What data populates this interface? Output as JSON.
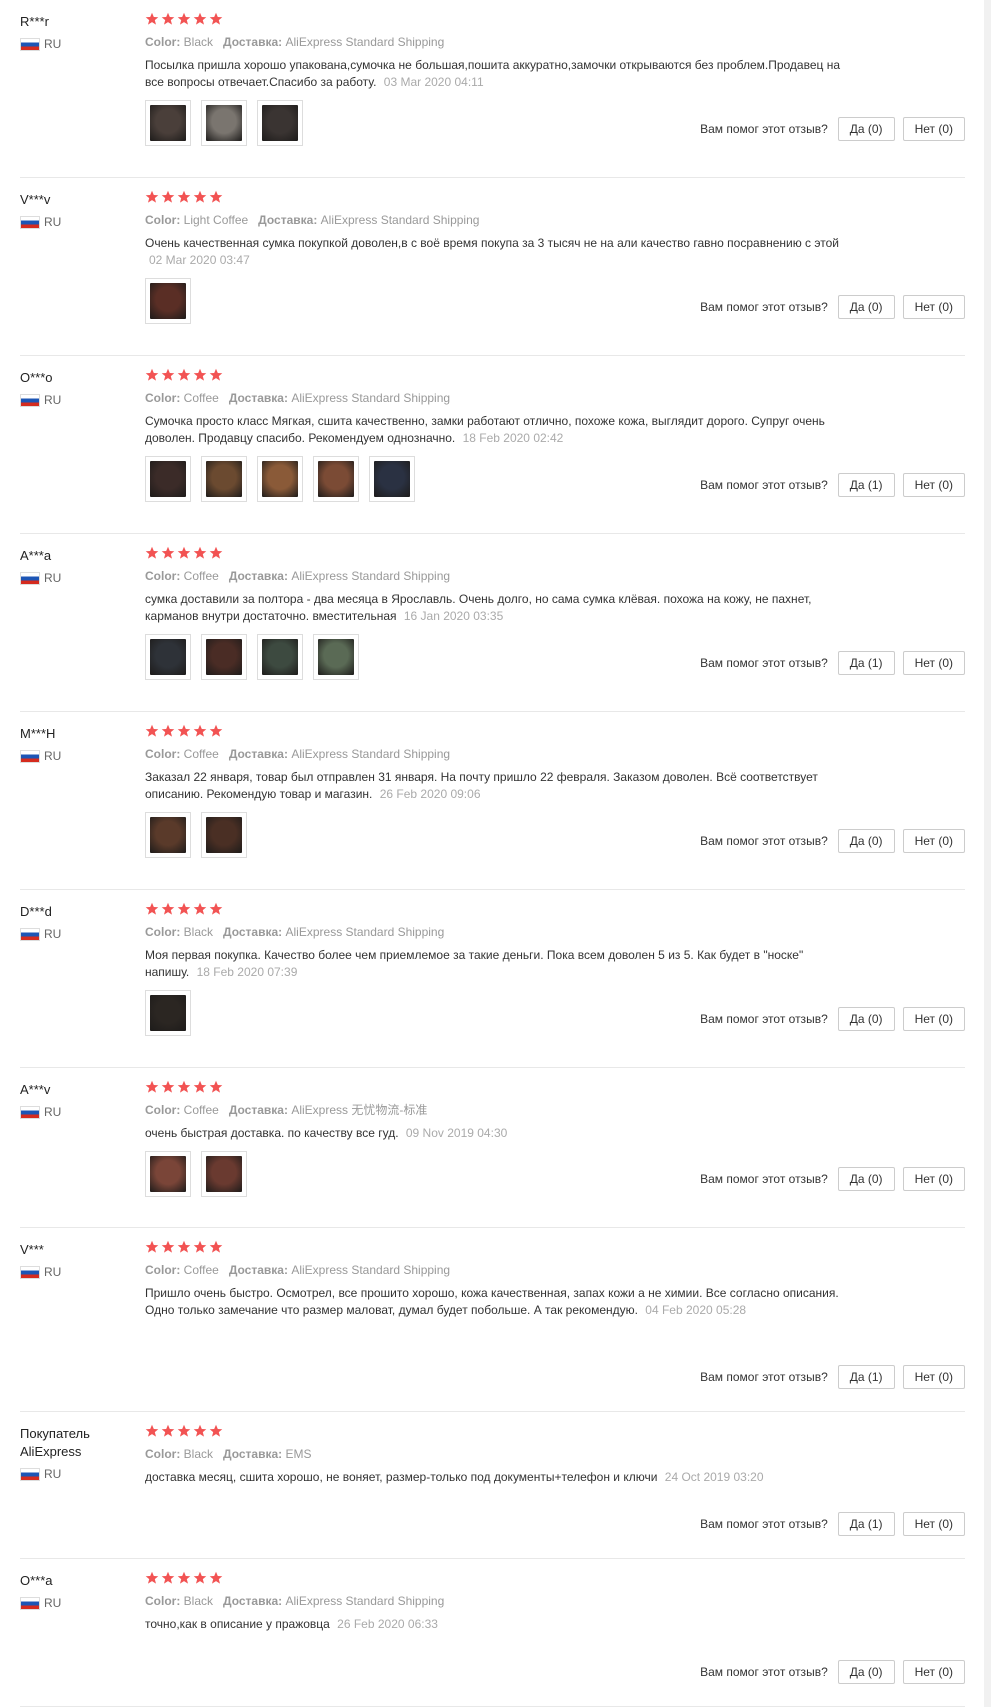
{
  "helpful_question": "Вам помог этот отзыв?",
  "color_key": "Color:",
  "shipping_key": "Доставка:",
  "colors": {
    "star": "#f25353",
    "country_text": "#666666"
  },
  "reviews": [
    {
      "user": "R***r",
      "country": "RU",
      "color": "Black",
      "shipping": "AliExpress Standard Shipping",
      "text": "Посылка пришла хорошо упакована,сумочка не большая,пошита аккуратно,замочки открываются без проблем.Продавец на все вопросы отвечает.Спасибо за работу.",
      "date": "03 Mar 2020 04:11",
      "photos": 3,
      "yes": "Да (0)",
      "no": "Нет (0)"
    },
    {
      "user": "V***v",
      "country": "RU",
      "color": "Light Coffee",
      "shipping": "AliExpress Standard Shipping",
      "text": "Очень качественная сумка покупкой доволен,в с воё время покупа за 3 тысяч не на али качество гавно посравнению с этой",
      "date": "02 Mar 2020 03:47",
      "photos": 1,
      "yes": "Да (0)",
      "no": "Нет (0)"
    },
    {
      "user": "O***o",
      "country": "RU",
      "color": "Coffee",
      "shipping": "AliExpress Standard Shipping",
      "text": "Сумочка просто класс Мягкая, сшита качественно, замки работают отлично, похоже кожа, выглядит дорого. Супруг очень доволен. Продавцу спасибо. Рекомендуем однозначно.",
      "date": "18 Feb 2020 02:42",
      "photos": 5,
      "yes": "Да (1)",
      "no": "Нет (0)"
    },
    {
      "user": "A***a",
      "country": "RU",
      "color": "Coffee",
      "shipping": "AliExpress Standard Shipping",
      "text": "сумка доставили за полтора - два месяца в Ярославль. Очень долго, но сама сумка клёвая. похожа на кожу, не пахнет, карманов внутри достаточно. вместительная",
      "date": "16 Jan 2020 03:35",
      "photos": 4,
      "yes": "Да (1)",
      "no": "Нет (0)"
    },
    {
      "user": "M***H",
      "country": "RU",
      "color": "Coffee",
      "shipping": "AliExpress Standard Shipping",
      "text": "Заказал 22 января, товар был отправлен 31 января. На почту пришло 22 февраля. Заказом доволен. Всё соответствует описанию. Рекомендую товар и магазин.",
      "date": "26 Feb 2020 09:06",
      "photos": 2,
      "yes": "Да (0)",
      "no": "Нет (0)"
    },
    {
      "user": "D***d",
      "country": "RU",
      "color": "Black",
      "shipping": "AliExpress Standard Shipping",
      "text": "Моя первая покупка. Качество более чем приемлемое за такие деньги. Пока всем доволен 5 из 5. Как будет в \"носке\" напишу.",
      "date": "18 Feb 2020 07:39",
      "photos": 1,
      "yes": "Да (0)",
      "no": "Нет (0)"
    },
    {
      "user": "A***v",
      "country": "RU",
      "color": "Coffee",
      "shipping": "AliExpress 无忧物流-标准",
      "text": "очень быстрая доставка. по качеству все гуд.",
      "date": "09 Nov 2019 04:30",
      "photos": 2,
      "yes": "Да (0)",
      "no": "Нет (0)"
    },
    {
      "user": "V***",
      "country": "RU",
      "color": "Coffee",
      "shipping": "AliExpress Standard Shipping",
      "text": "Пришло очень быстро. Осмотрел, все прошито хорошо, кожа качественная, запах кожи а не химии. Все согласно описания. Одно только замечание что размер маловат, думал будет побольше. А так рекомендую.",
      "date": "04 Feb 2020 05:28",
      "photos": 0,
      "yes": "Да (1)",
      "no": "Нет (0)"
    },
    {
      "user": "Покупатель AliExpress",
      "country": "RU",
      "color": "Black",
      "shipping": "EMS",
      "text": "доставка месяц, сшита хорошо, не воняет, размер-только под документы+телефон и ключи",
      "date": "24 Oct 2019 03:20",
      "photos": 0,
      "yes": "Да (1)",
      "no": "Нет (0)"
    },
    {
      "user": "O***a",
      "country": "RU",
      "color": "Black",
      "shipping": "AliExpress Standard Shipping",
      "text": "точно,как в описание у пражовца",
      "date": "26 Feb 2020 06:33",
      "photos": 0,
      "yes": "Да (0)",
      "no": "Нет (0)"
    }
  ]
}
